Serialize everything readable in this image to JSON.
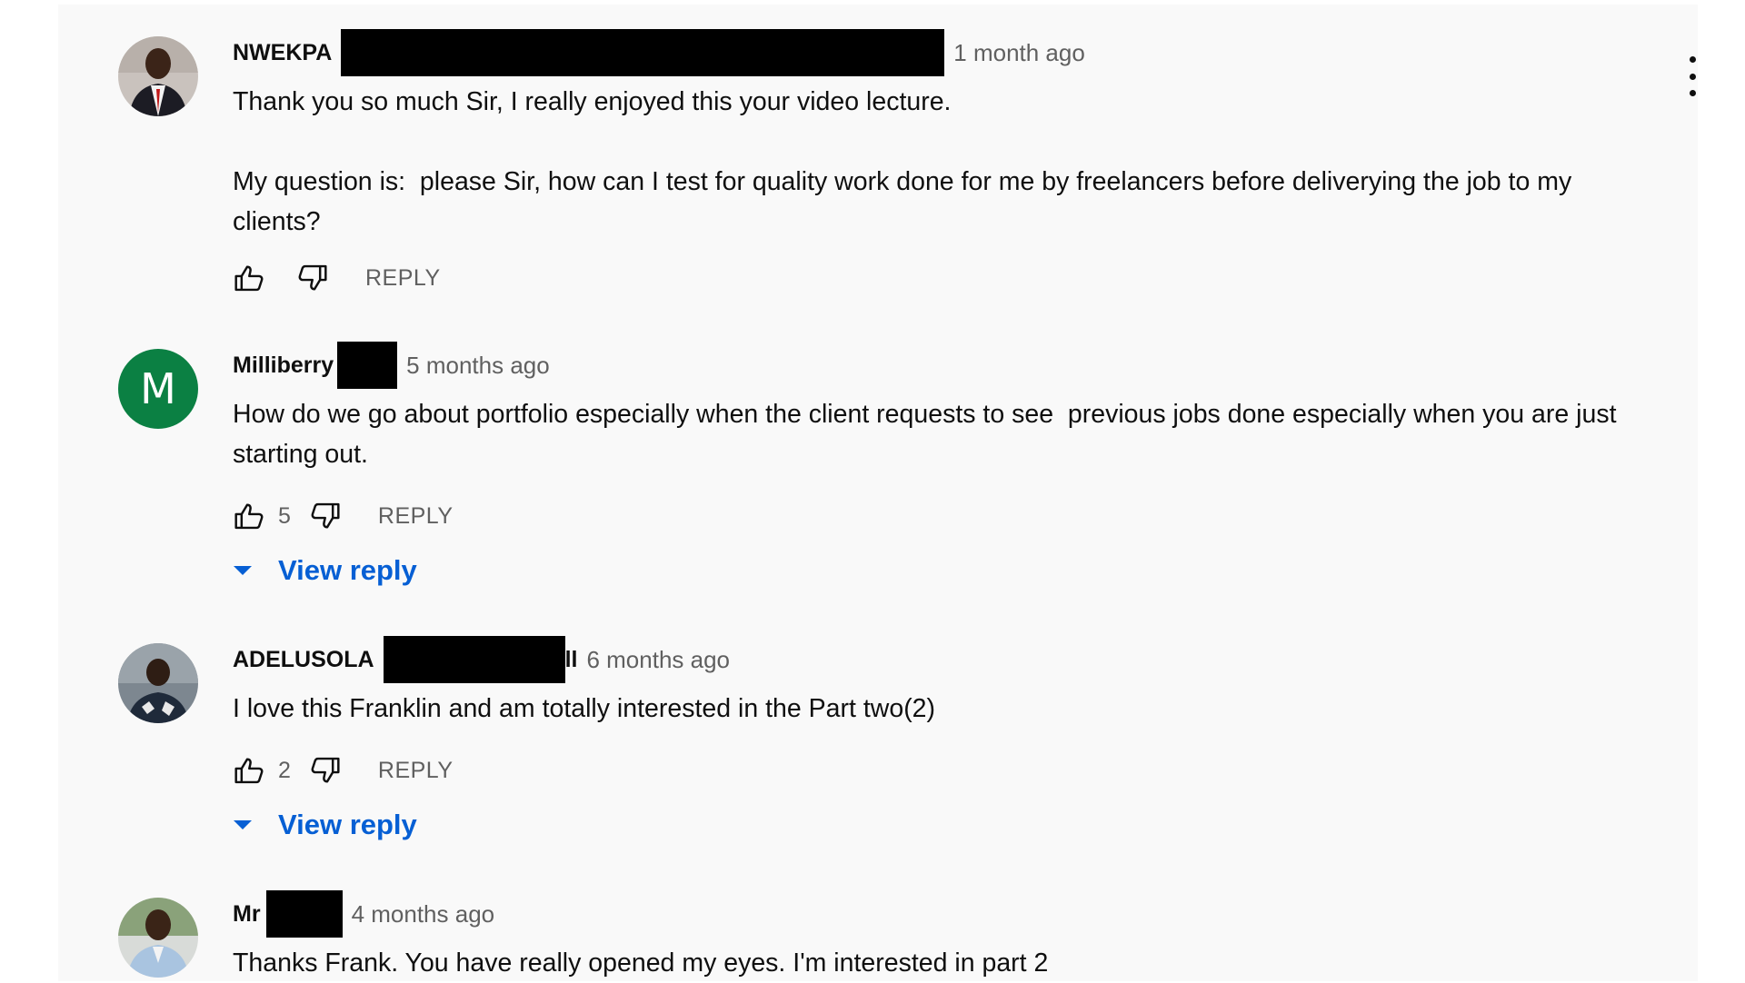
{
  "comments": [
    {
      "author": "NWEKPA",
      "author_tail": "",
      "time": "1 month ago",
      "text": "Thank you so much Sir, I really enjoyed this your video lecture.\n\nMy question is:  please Sir, how can I test for quality work done for me by freelancers before deliverying the job to my clients?",
      "likes": "",
      "reply_label": "REPLY"
    },
    {
      "author": "Milliberry",
      "author_tail": "",
      "avatar_letter": "M",
      "time": "5 months ago",
      "text": "How do we go about portfolio especially when the client requests to see  previous jobs done especially when you are just starting out.",
      "likes": "5",
      "reply_label": "REPLY",
      "view_reply": "View reply"
    },
    {
      "author": "ADELUSOLA",
      "author_tail": "ll",
      "time": "6 months ago",
      "text": "I love this Franklin and am totally interested in the Part two(2)",
      "likes": "2",
      "reply_label": "REPLY",
      "view_reply": "View reply"
    },
    {
      "author": "Mr",
      "author_tail": "",
      "time": "4 months ago",
      "text": "Thanks Frank. You have really opened my eyes. I'm interested in part 2"
    }
  ],
  "colors": {
    "panel_bg": "#f9f9f9",
    "link_blue": "#065fd4",
    "meta_gray": "#606060",
    "avatar_green": "#0b8043"
  }
}
